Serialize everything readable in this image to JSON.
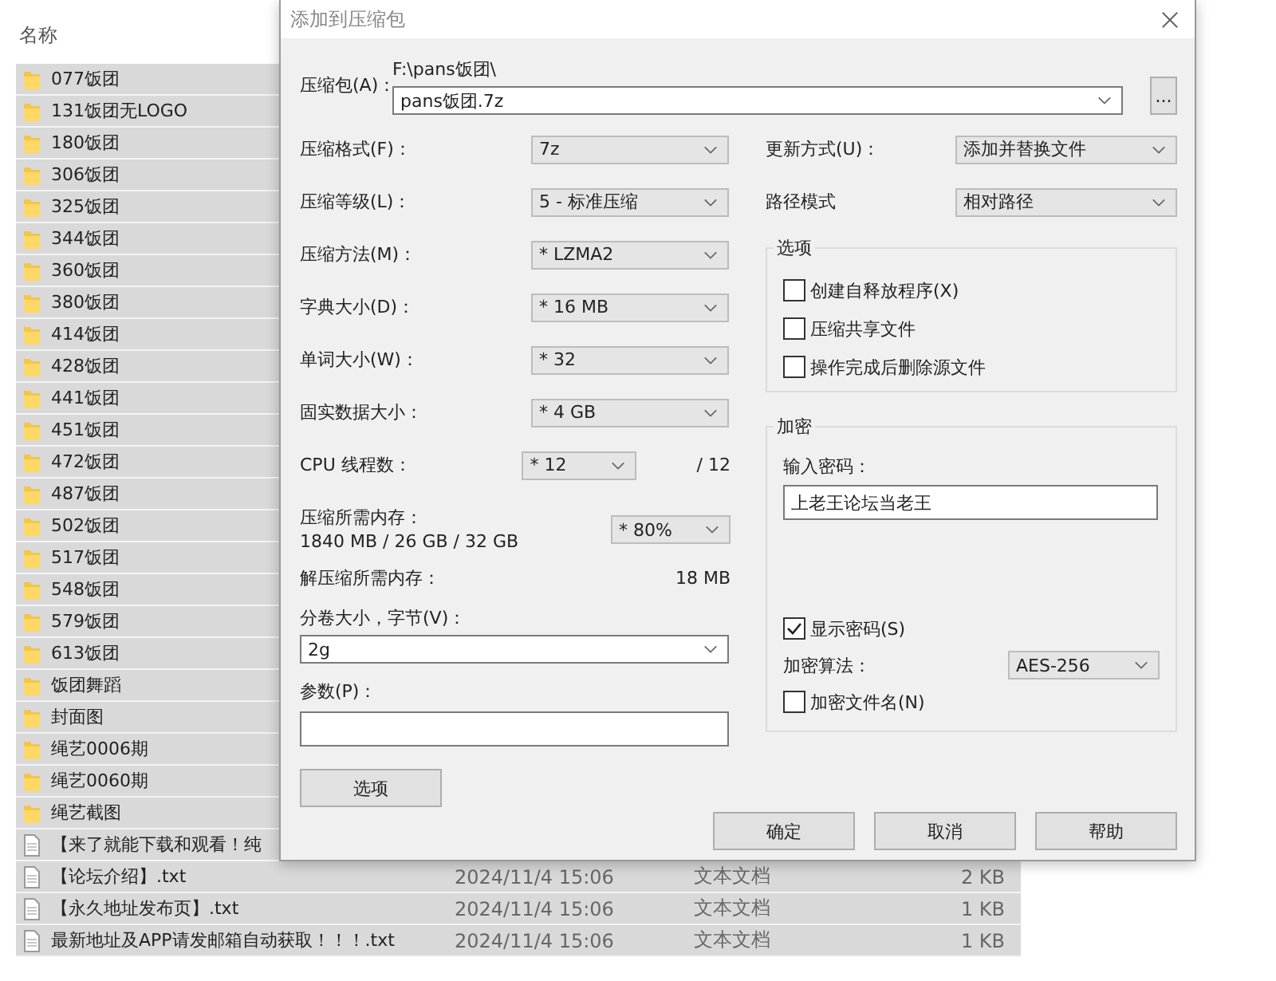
{
  "explorer": {
    "column_header": "名称",
    "rows": [
      {
        "kind": "folder",
        "name": "077饭团"
      },
      {
        "kind": "folder",
        "name": "131饭团无LOGO"
      },
      {
        "kind": "folder",
        "name": "180饭团"
      },
      {
        "kind": "folder",
        "name": "306饭团"
      },
      {
        "kind": "folder",
        "name": "325饭团"
      },
      {
        "kind": "folder",
        "name": "344饭团"
      },
      {
        "kind": "folder",
        "name": "360饭团"
      },
      {
        "kind": "folder",
        "name": "380饭团"
      },
      {
        "kind": "folder",
        "name": "414饭团"
      },
      {
        "kind": "folder",
        "name": "428饭团"
      },
      {
        "kind": "folder",
        "name": "441饭团"
      },
      {
        "kind": "folder",
        "name": "451饭团"
      },
      {
        "kind": "folder",
        "name": "472饭团"
      },
      {
        "kind": "folder",
        "name": "487饭团"
      },
      {
        "kind": "folder",
        "name": "502饭团"
      },
      {
        "kind": "folder",
        "name": "517饭团"
      },
      {
        "kind": "folder",
        "name": "548饭团"
      },
      {
        "kind": "folder",
        "name": "579饭团"
      },
      {
        "kind": "folder",
        "name": "613饭团"
      },
      {
        "kind": "folder",
        "name": "饭团舞蹈"
      },
      {
        "kind": "folder",
        "name": "封面图"
      },
      {
        "kind": "folder",
        "name": "绳艺0006期"
      },
      {
        "kind": "folder",
        "name": "绳艺0060期"
      },
      {
        "kind": "folder",
        "name": "绳艺截图"
      },
      {
        "kind": "file",
        "name": "【来了就能下载和观看！纯"
      },
      {
        "kind": "file",
        "name": "【论坛介绍】.txt",
        "date": "2024/11/4 15:06",
        "type": "文本文档",
        "size": "2 KB"
      },
      {
        "kind": "file",
        "name": "【永久地址发布页】.txt",
        "date": "2024/11/4 15:06",
        "type": "文本文档",
        "size": "1 KB"
      },
      {
        "kind": "file",
        "name": "最新地址及APP请发邮箱自动获取！！！.txt",
        "date": "2024/11/4 15:06",
        "type": "文本文档",
        "size": "1 KB"
      }
    ]
  },
  "dialog": {
    "title": "添加到压缩包",
    "archive": {
      "label": "压缩包(A)：",
      "path": "F:\\pans饭团\\",
      "value": "pans饭团.7z",
      "browse": "..."
    },
    "settings": [
      {
        "label": "压缩格式(F)：",
        "value": "7z"
      },
      {
        "label": "压缩等级(L)：",
        "value": "5 - 标准压缩"
      },
      {
        "label": "压缩方法(M)：",
        "value": "* LZMA2"
      },
      {
        "label": "字典大小(D)：",
        "value": "* 16 MB"
      },
      {
        "label": "单词大小(W)：",
        "value": "* 32"
      },
      {
        "label": "固实数据大小：",
        "value": "* 4 GB"
      }
    ],
    "threads": {
      "label": "CPU 线程数：",
      "value": "* 12",
      "max": "/ 12"
    },
    "memory": {
      "label": "压缩所需内存：",
      "reading": "1840 MB / 26 GB / 32 GB",
      "value": "* 80%"
    },
    "decompress_memory": {
      "label": "解压缩所需内存：",
      "reading": "18 MB"
    },
    "split": {
      "label": "分卷大小，字节(V)：",
      "value": "2g"
    },
    "params": {
      "label": "参数(P)："
    },
    "options_button": "选项",
    "update_mode": {
      "label": "更新方式(U)：",
      "value": "添加并替换文件"
    },
    "path_mode": {
      "label": "路径模式",
      "value": "相对路径"
    },
    "options_group": {
      "title": "选项",
      "items": [
        {
          "label": "创建自释放程序(X)",
          "checked": false
        },
        {
          "label": "压缩共享文件",
          "checked": false
        },
        {
          "label": "操作完成后删除源文件",
          "checked": false
        }
      ]
    },
    "encryption": {
      "title": "加密",
      "password_label": "输入密码：",
      "password": "上老王论坛当老王",
      "show_password": {
        "label": "显示密码(S)",
        "checked": true
      },
      "method_label": "加密算法：",
      "method": "AES-256",
      "encrypt_names": {
        "label": "加密文件名(N)",
        "checked": false
      }
    },
    "buttons": [
      "确定",
      "取消",
      "帮助"
    ]
  }
}
